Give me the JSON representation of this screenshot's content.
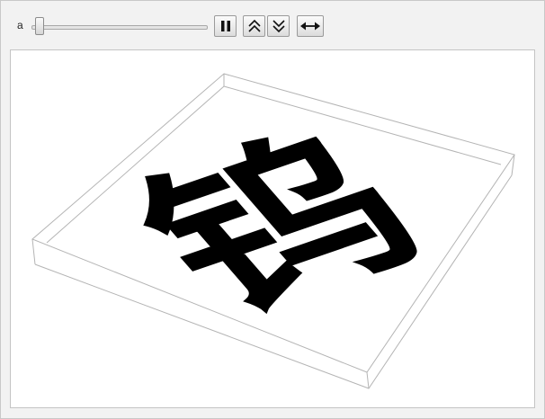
{
  "controls": {
    "parameter_label": "a",
    "slider_value": 0.03,
    "buttons": {
      "pause": "pause-icon",
      "faster": "double-chevron-up-icon",
      "slower": "double-chevron-down-icon",
      "direction": "double-arrow-horizontal-icon"
    }
  },
  "plot": {
    "glyph_text": "钨",
    "box_line_color": "#b4b4b4",
    "glyph_color": "#000000"
  }
}
